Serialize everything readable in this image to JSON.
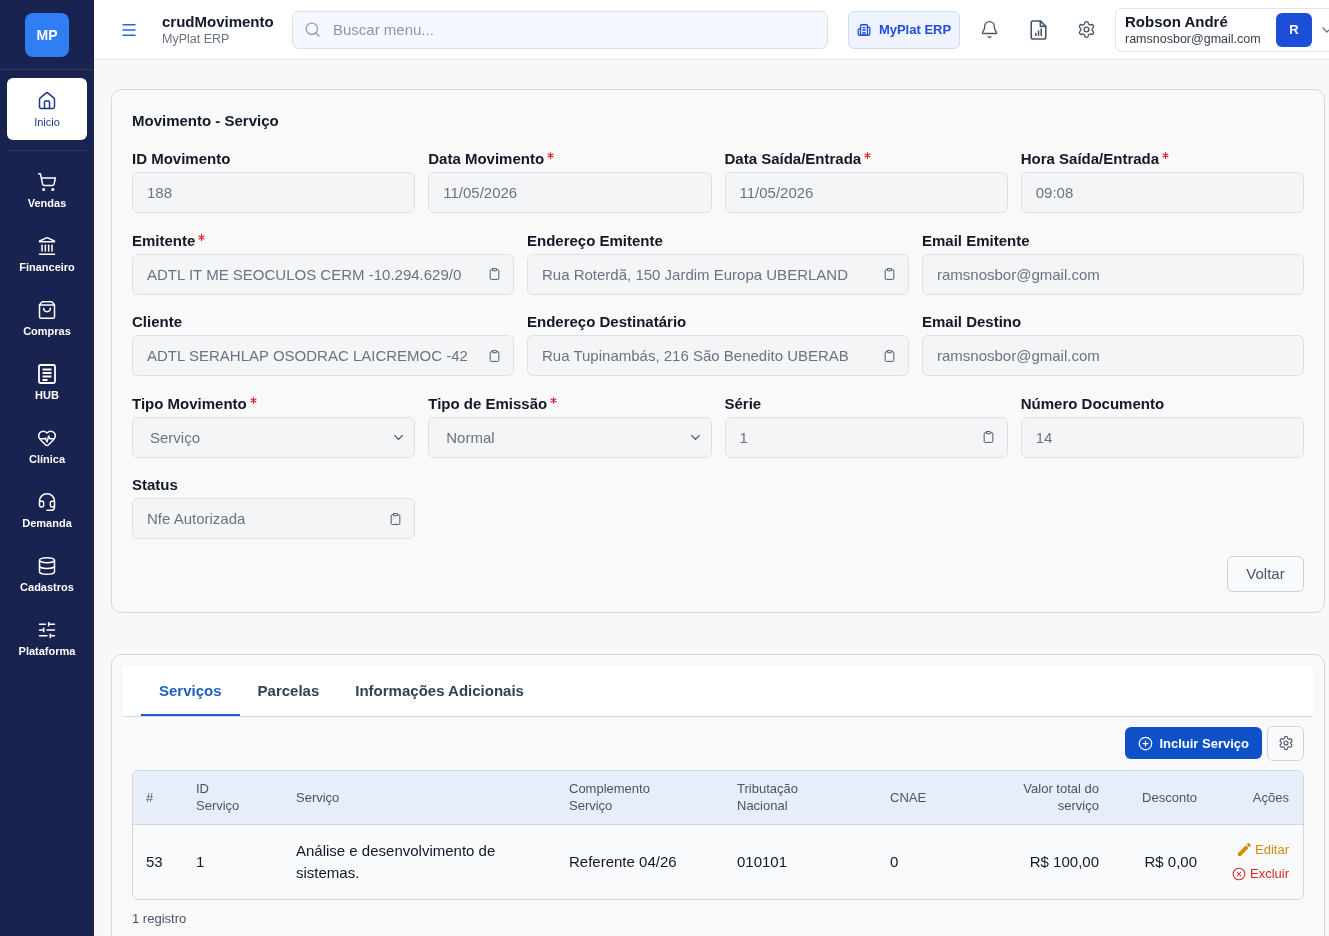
{
  "sidebar": {
    "logo": "MP",
    "items": [
      {
        "label": "Inicio",
        "selected": true
      },
      {
        "label": "Vendas",
        "selected": false
      },
      {
        "label": "Financeiro",
        "selected": false
      },
      {
        "label": "Compras",
        "selected": false
      },
      {
        "label": "HUB",
        "selected": false
      },
      {
        "label": "Clínica",
        "selected": false
      },
      {
        "label": "Demanda",
        "selected": false
      },
      {
        "label": "Cadastros",
        "selected": false
      },
      {
        "label": "Plataforma",
        "selected": false
      }
    ]
  },
  "topbar": {
    "title": "crudMovimento",
    "subtitle": "MyPlat ERP",
    "search": {
      "placeholder": "Buscar menu..."
    },
    "company_button": "MyPlat ERP",
    "user": {
      "name": "Robson André",
      "email": "ramsnosbor@gmail.com",
      "avatar": "R"
    }
  },
  "form": {
    "title": "Movimento - Serviço",
    "rows": [
      [
        {
          "label": "ID Movimento",
          "required": false,
          "kind": "text",
          "value": "188",
          "copyable": false
        },
        {
          "label": "Data Movimento",
          "required": true,
          "kind": "text",
          "value": "11/05/2026",
          "copyable": false
        },
        {
          "label": "Data Saída/Entrada",
          "required": true,
          "kind": "text",
          "value": "11/05/2026",
          "copyable": false
        },
        {
          "label": "Hora Saída/Entrada",
          "required": true,
          "kind": "text",
          "value": "09:08",
          "copyable": false
        }
      ],
      [
        {
          "label": "Emitente",
          "required": true,
          "kind": "text",
          "value": "ADTL IT ME SEOCULOS CERM -10.294.629/0",
          "copyable": true
        },
        {
          "label": "Endereço Emitente",
          "required": false,
          "kind": "text",
          "value": "Rua Roterdã, 150 Jardim Europa UBERLAND",
          "copyable": true
        },
        {
          "label": "Email Emitente",
          "required": false,
          "kind": "text",
          "value": "ramsnosbor@gmail.com",
          "copyable": false
        }
      ],
      [
        {
          "label": "Cliente",
          "required": false,
          "kind": "text",
          "value": "ADTL SERAHLAP OSODRAC LAICREMOC -42",
          "copyable": true
        },
        {
          "label": "Endereço Destinatário",
          "required": false,
          "kind": "text",
          "value": "Rua Tupinambás, 216 São Benedito UBERAB",
          "copyable": true
        },
        {
          "label": "Email Destino",
          "required": false,
          "kind": "text",
          "value": "ramsnosbor@gmail.com",
          "copyable": false
        }
      ],
      [
        {
          "label": "Tipo Movimento",
          "required": true,
          "kind": "select",
          "value": "Serviço",
          "copyable": false
        },
        {
          "label": "Tipo de Emissão",
          "required": true,
          "kind": "select",
          "value": "Normal",
          "copyable": false
        },
        {
          "label": "Série",
          "required": false,
          "kind": "text",
          "value": "1",
          "copyable": true
        },
        {
          "label": "Número Documento",
          "required": false,
          "kind": "text",
          "value": "14",
          "copyable": false
        }
      ],
      [
        {
          "label": "Status",
          "required": false,
          "kind": "text",
          "value": "Nfe Autorizada",
          "copyable": true
        }
      ]
    ],
    "back_button": "Voltar"
  },
  "details": {
    "tabs": [
      {
        "label": "Serviços",
        "selected": true
      },
      {
        "label": "Parcelas",
        "selected": false
      },
      {
        "label": "Informações Adicionais",
        "selected": false
      }
    ],
    "add_button": "Incluir Serviço",
    "table": {
      "columns": [
        "#",
        "ID Serviço",
        "Serviço",
        "Complemento Serviço",
        "Tributação Nacional",
        "CNAE",
        "Valor total do serviço",
        "Desconto",
        "Ações"
      ],
      "rows": [
        {
          "cells": [
            "53",
            "1",
            "Análise e desenvolvimento de sistemas.",
            "Referente 04/26",
            "010101",
            "0",
            "R$ 100,00",
            "R$ 0,00"
          ],
          "actions": [
            {
              "kind": "edit",
              "label": "Editar"
            },
            {
              "kind": "delete",
              "label": "Excluir"
            }
          ]
        }
      ]
    },
    "footer": "1 registro"
  }
}
